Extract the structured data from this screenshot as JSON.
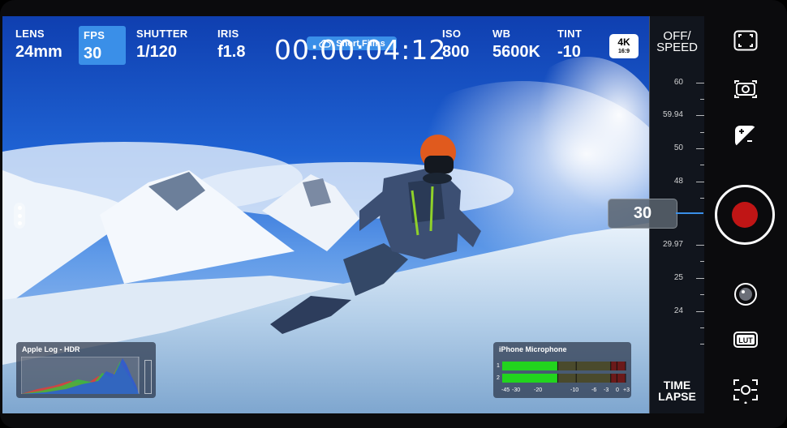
{
  "hud": {
    "lens": {
      "label": "LENS",
      "value": "24mm"
    },
    "fps": {
      "label": "FPS",
      "value": "30"
    },
    "shutter": {
      "label": "SHUTTER",
      "value": "1/120"
    },
    "iris": {
      "label": "IRIS",
      "value": "f1.8"
    },
    "timecode": "00:00:04:12",
    "project": "Short Films",
    "iso": {
      "label": "ISO",
      "value": "800"
    },
    "wb": {
      "label": "WB",
      "value": "5600K"
    },
    "tint": {
      "label": "TINT",
      "value": "-10"
    },
    "resolution": {
      "main": "4K",
      "aspect": "16:9"
    }
  },
  "dial": {
    "top_label": "OFF/\nSPEED",
    "bottom_label": "TIME\nLAPSE",
    "ticks": [
      "60",
      "59.94",
      "50",
      "48",
      "29.97",
      "25",
      "24"
    ],
    "current": "30"
  },
  "histogram": {
    "title": "Apple Log - HDR"
  },
  "audio": {
    "title": "iPhone Microphone",
    "channels": [
      "1",
      "2"
    ],
    "scale": [
      "-45",
      "-30",
      "-20",
      "-10",
      "-6",
      "-3",
      "0",
      "+3"
    ],
    "levels": [
      0.45,
      0.45
    ]
  },
  "controls": {
    "icons": [
      "frame-guides-icon",
      "camera-switch-icon",
      "exposure-icon",
      "record-button",
      "lens-icon",
      "lut-icon",
      "focus-icon"
    ],
    "lut_label": "LUT"
  },
  "colors": {
    "accent": "#3a8fe8",
    "record": "#c01515"
  }
}
